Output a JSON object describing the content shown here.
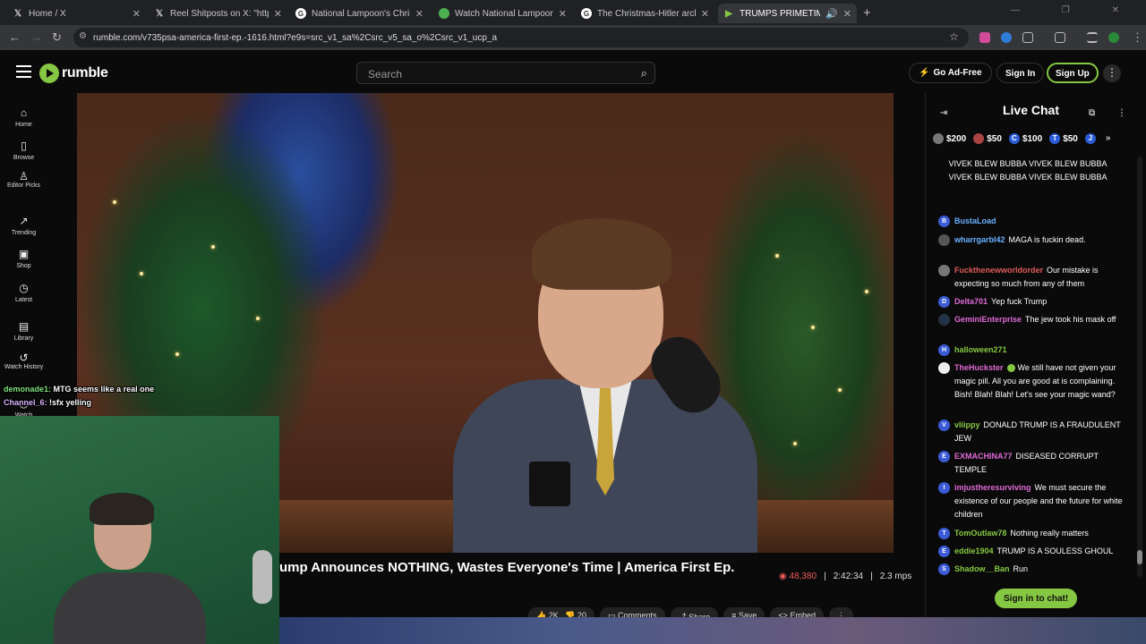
{
  "browser": {
    "tabs": [
      {
        "title": "Home / X",
        "icon": "x-logo-icon"
      },
      {
        "title": "Reel Shitposts on X: \"https://t.co",
        "icon": "x-logo-icon"
      },
      {
        "title": "National Lampoon's Christmas",
        "icon": "globe-icon"
      },
      {
        "title": "Watch National Lampoon's Ch",
        "icon": "globe-icon"
      },
      {
        "title": "The Christmas-Hitler archive - ",
        "icon": "globe-icon"
      },
      {
        "title": "TRUMPS PRIMETIME FLOP",
        "icon": "rumble-icon",
        "active": true
      }
    ],
    "new_tab": "+",
    "url": "rumble.com/v735psa-america-first-ep.-1616.html?e9s=src_v1_sa%2Csrc_v5_sa_o%2Csrc_v1_ucp_a"
  },
  "header": {
    "logo": "rumble",
    "search_placeholder": "Search",
    "ad_free": "Go Ad-Free",
    "sign_in": "Sign In",
    "sign_up": "Sign Up"
  },
  "sidebar": [
    {
      "label": "Home",
      "icon": "home-icon"
    },
    {
      "label": "Browse",
      "icon": "browse-icon"
    },
    {
      "label": "Editor Picks",
      "icon": "editor-picks-icon"
    },
    {
      "label": "Trending",
      "icon": "trending-icon"
    },
    {
      "label": "Shop",
      "icon": "shop-icon"
    },
    {
      "label": "Latest",
      "icon": "latest-icon"
    },
    {
      "label": "Library",
      "icon": "library-icon"
    },
    {
      "label": "Watch History",
      "icon": "history-icon"
    },
    {
      "label": "Watch",
      "icon": "watch-icon"
    }
  ],
  "overlay_chat": [
    {
      "user": "demonade1:",
      "text": "MTG seems like a real one"
    },
    {
      "user": "Channel_6:",
      "text": "!sfx yelling"
    }
  ],
  "video": {
    "title": "ump Announces NOTHING, Wastes Everyone's Time | America First Ep.",
    "views": "48,380",
    "duration": "2:42:34",
    "rate": "2.3 mps",
    "likes": "2K",
    "dislikes": "20",
    "comments": "Comments",
    "share": "Share",
    "save": "Save",
    "embed": "Embed"
  },
  "chat": {
    "title": "Live Chat",
    "rants": [
      {
        "amount": "$200"
      },
      {
        "amount": "$50"
      },
      {
        "amount": "$100",
        "initial": "C"
      },
      {
        "amount": "$50",
        "initial": "T"
      },
      {
        "amount": "",
        "initial": "J"
      }
    ],
    "messages": [
      {
        "text": "VIVEK BLEW BUBBA VIVEK BLEW BUBBA VIVEK BLEW BUBBA VIVEK BLEW BUBBA"
      },
      {
        "initial": "B",
        "user": "BustaLoad",
        "text": ""
      },
      {
        "initial": "",
        "user": "wharrgarbl42",
        "text": "MAGA is fuckin dead."
      },
      {
        "initial": "",
        "user": "Fuckthenewworldorder",
        "text": "Our mistake is expecting so much from any of them"
      },
      {
        "initial": "D",
        "user": "Delta701",
        "text": "Yep fuck Trump"
      },
      {
        "initial": "",
        "user": "GeminiEnterprise",
        "text": "The jew took his mask off"
      },
      {
        "initial": "H",
        "user": "halloween271",
        "text": ""
      },
      {
        "initial": "",
        "user": "TheHuckster",
        "text": "We still have not given your magic pill. All you are good at is complaining. Bish! Blah! Blah! Let's see your magic wand?"
      },
      {
        "initial": "V",
        "user": "vliippy",
        "text": "DONALD TRUMP IS A FRAUDULENT JEW"
      },
      {
        "initial": "E",
        "user": "EXMACHINA77",
        "text": "DISEASED CORRUPT TEMPLE"
      },
      {
        "initial": "I",
        "user": "imjustheresurviving",
        "text": "We must secure the existence of our people and the future for white children"
      },
      {
        "initial": "T",
        "user": "TomOutlaw78",
        "text": "Nothing really matters"
      },
      {
        "initial": "E",
        "user": "eddie1904",
        "text": "TRUMP IS A SOULESS GHOUL"
      },
      {
        "initial": "S",
        "user": "Shadow__Ban",
        "text": "Run"
      }
    ],
    "sign_in_chat": "Sign in to chat!"
  },
  "colors": {
    "accent": "#85c742",
    "views": "#f05a5a"
  }
}
